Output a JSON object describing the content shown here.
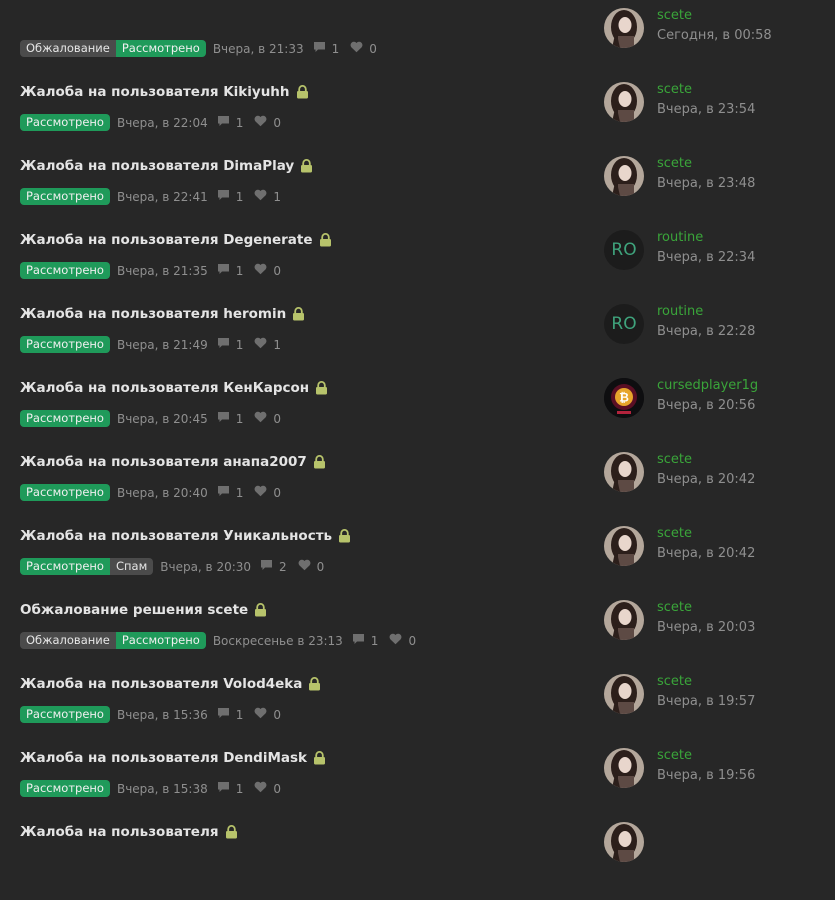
{
  "threads": [
    {
      "title": "",
      "tags": [
        {
          "label": "Обжалование",
          "color": "grey"
        },
        {
          "label": "Рассмотрено",
          "color": "green"
        }
      ],
      "date": "Вчера, в 21:33",
      "replies": "1",
      "likes": "0",
      "user": "scete",
      "last": "Сегодня, в 00:58",
      "avatar": "photo"
    },
    {
      "title": "Жалоба на пользователя Kikiyuhh",
      "tags": [
        {
          "label": "Рассмотрено",
          "color": "green"
        }
      ],
      "date": "Вчера, в 22:04",
      "replies": "1",
      "likes": "0",
      "user": "scete",
      "last": "Вчера, в 23:54",
      "avatar": "photo"
    },
    {
      "title": "Жалоба на пользователя DimaPlay",
      "tags": [
        {
          "label": "Рассмотрено",
          "color": "green"
        }
      ],
      "date": "Вчера, в 22:41",
      "replies": "1",
      "likes": "1",
      "user": "scete",
      "last": "Вчера, в 23:48",
      "avatar": "photo"
    },
    {
      "title": "Жалоба на пользователя Degenerate",
      "tags": [
        {
          "label": "Рассмотрено",
          "color": "green"
        }
      ],
      "date": "Вчера, в 21:35",
      "replies": "1",
      "likes": "0",
      "user": "routine",
      "last": "Вчера, в 22:34",
      "avatar": "ro",
      "avatar_text": "RO"
    },
    {
      "title": "Жалоба на пользователя heromin",
      "tags": [
        {
          "label": "Рассмотрено",
          "color": "green"
        }
      ],
      "date": "Вчера, в 21:49",
      "replies": "1",
      "likes": "1",
      "user": "routine",
      "last": "Вчера, в 22:28",
      "avatar": "ro",
      "avatar_text": "RO"
    },
    {
      "title": "Жалоба на пользователя КенКарсон",
      "tags": [
        {
          "label": "Рассмотрено",
          "color": "green"
        }
      ],
      "date": "Вчера, в 20:45",
      "replies": "1",
      "likes": "0",
      "user": "cursedplayer1g",
      "last": "Вчера, в 20:56",
      "avatar": "coin"
    },
    {
      "title": "Жалоба на пользователя анапа2007",
      "tags": [
        {
          "label": "Рассмотрено",
          "color": "green"
        }
      ],
      "date": "Вчера, в 20:40",
      "replies": "1",
      "likes": "0",
      "user": "scete",
      "last": "Вчера, в 20:42",
      "avatar": "photo"
    },
    {
      "title": "Жалоба на пользователя Уникальность",
      "tags": [
        {
          "label": "Рассмотрено",
          "color": "green"
        },
        {
          "label": "Спам",
          "color": "grey"
        }
      ],
      "date": "Вчера, в 20:30",
      "replies": "2",
      "likes": "0",
      "user": "scete",
      "last": "Вчера, в 20:42",
      "avatar": "photo"
    },
    {
      "title": "Обжалование решения scete",
      "tags": [
        {
          "label": "Обжалование",
          "color": "grey"
        },
        {
          "label": "Рассмотрено",
          "color": "green"
        }
      ],
      "date": "Воскресенье в 23:13",
      "replies": "1",
      "likes": "0",
      "user": "scete",
      "last": "Вчера, в 20:03",
      "avatar": "photo"
    },
    {
      "title": "Жалоба на пользователя Volod4eka",
      "tags": [
        {
          "label": "Рассмотрено",
          "color": "green"
        }
      ],
      "date": "Вчера, в 15:36",
      "replies": "1",
      "likes": "0",
      "user": "scete",
      "last": "Вчера, в 19:57",
      "avatar": "photo"
    },
    {
      "title": "Жалоба на пользователя DendiMask",
      "tags": [
        {
          "label": "Рассмотрено",
          "color": "green"
        }
      ],
      "date": "Вчера, в 15:38",
      "replies": "1",
      "likes": "0",
      "user": "scete",
      "last": "Вчера, в 19:56",
      "avatar": "photo"
    },
    {
      "title": "Жалоба на пользователя",
      "tags": [],
      "date": "",
      "replies": "",
      "likes": "",
      "user": "",
      "last": "",
      "avatar": "photo"
    }
  ],
  "icons": {
    "lock": "lock-icon",
    "replies": "comment-icon",
    "likes": "heart-icon"
  },
  "colors": {
    "background": "#272727",
    "tag_green": "#1f9a5a",
    "tag_grey": "#4b4b4b",
    "username": "#3aa53a",
    "lock": "#b7c36b",
    "muted": "#8f8f8f"
  }
}
